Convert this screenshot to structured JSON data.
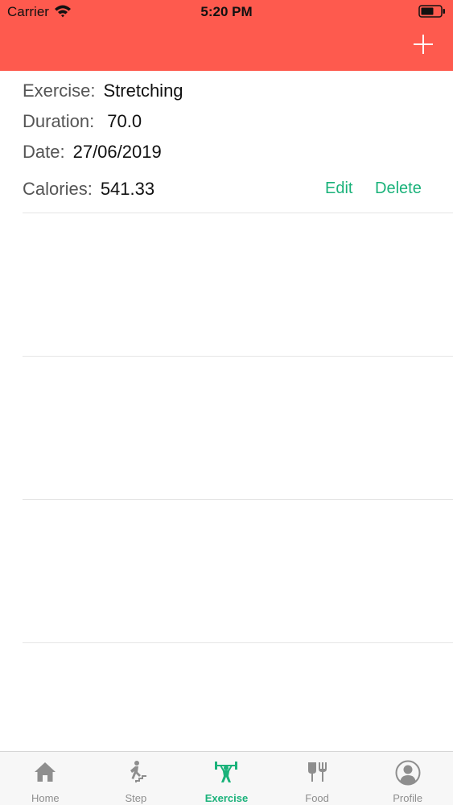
{
  "status_bar": {
    "carrier": "Carrier",
    "time": "5:20 PM"
  },
  "header": {
    "add_icon": "plus-icon",
    "color": "#fe5a4e"
  },
  "exercises": [
    {
      "exercise_label": "Exercise:",
      "exercise_value": "Stretching",
      "duration_label": "Duration:",
      "duration_value": "70.0",
      "date_label": "Date:",
      "date_value": "27/06/2019",
      "calories_label": "Calories:",
      "calories_value": "541.33",
      "edit_label": "Edit",
      "delete_label": "Delete"
    }
  ],
  "tabs": [
    {
      "label": "Home",
      "icon": "home-icon"
    },
    {
      "label": "Step",
      "icon": "step-icon"
    },
    {
      "label": "Exercise",
      "icon": "weightlifting-icon",
      "active": true
    },
    {
      "label": "Food",
      "icon": "food-icon"
    },
    {
      "label": "Profile",
      "icon": "profile-icon"
    }
  ],
  "colors": {
    "accent": "#1ab27a",
    "inactive": "#8e8e8e"
  }
}
